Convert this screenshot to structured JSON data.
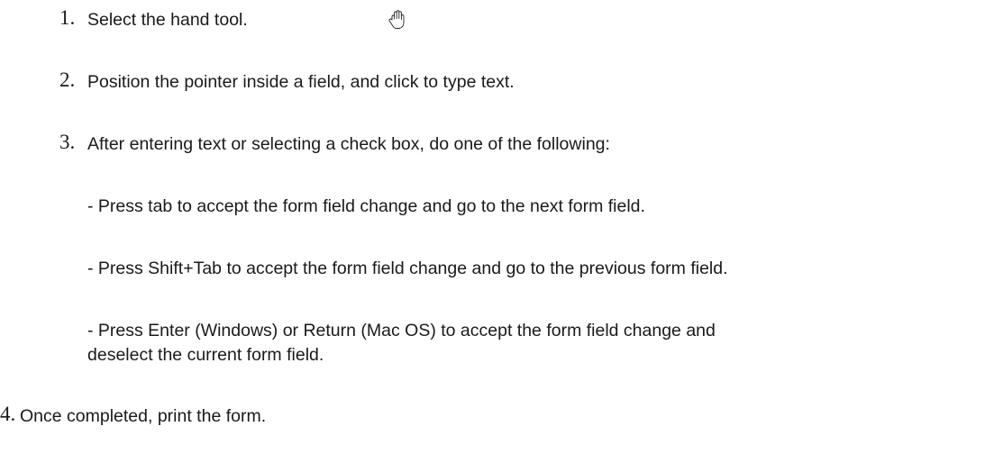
{
  "steps": [
    {
      "number": "1.",
      "text": "Select the hand tool.",
      "icon": "hand-tool-icon"
    },
    {
      "number": "2.",
      "text": "Position the pointer inside a field, and click to type text."
    },
    {
      "number": "3.",
      "text": "After entering text or selecting a check box, do one of the following:"
    }
  ],
  "sub_steps": [
    "- Press tab to accept the form field change and go to the next form field.",
    "- Press Shift+Tab to accept the form field change and go to the previous form field.",
    "- Press Enter (Windows) or Return (Mac OS) to accept the form field change and",
    "deselect the current form field."
  ],
  "final_step": {
    "number": "4.",
    "text": "Once completed, print the form."
  }
}
